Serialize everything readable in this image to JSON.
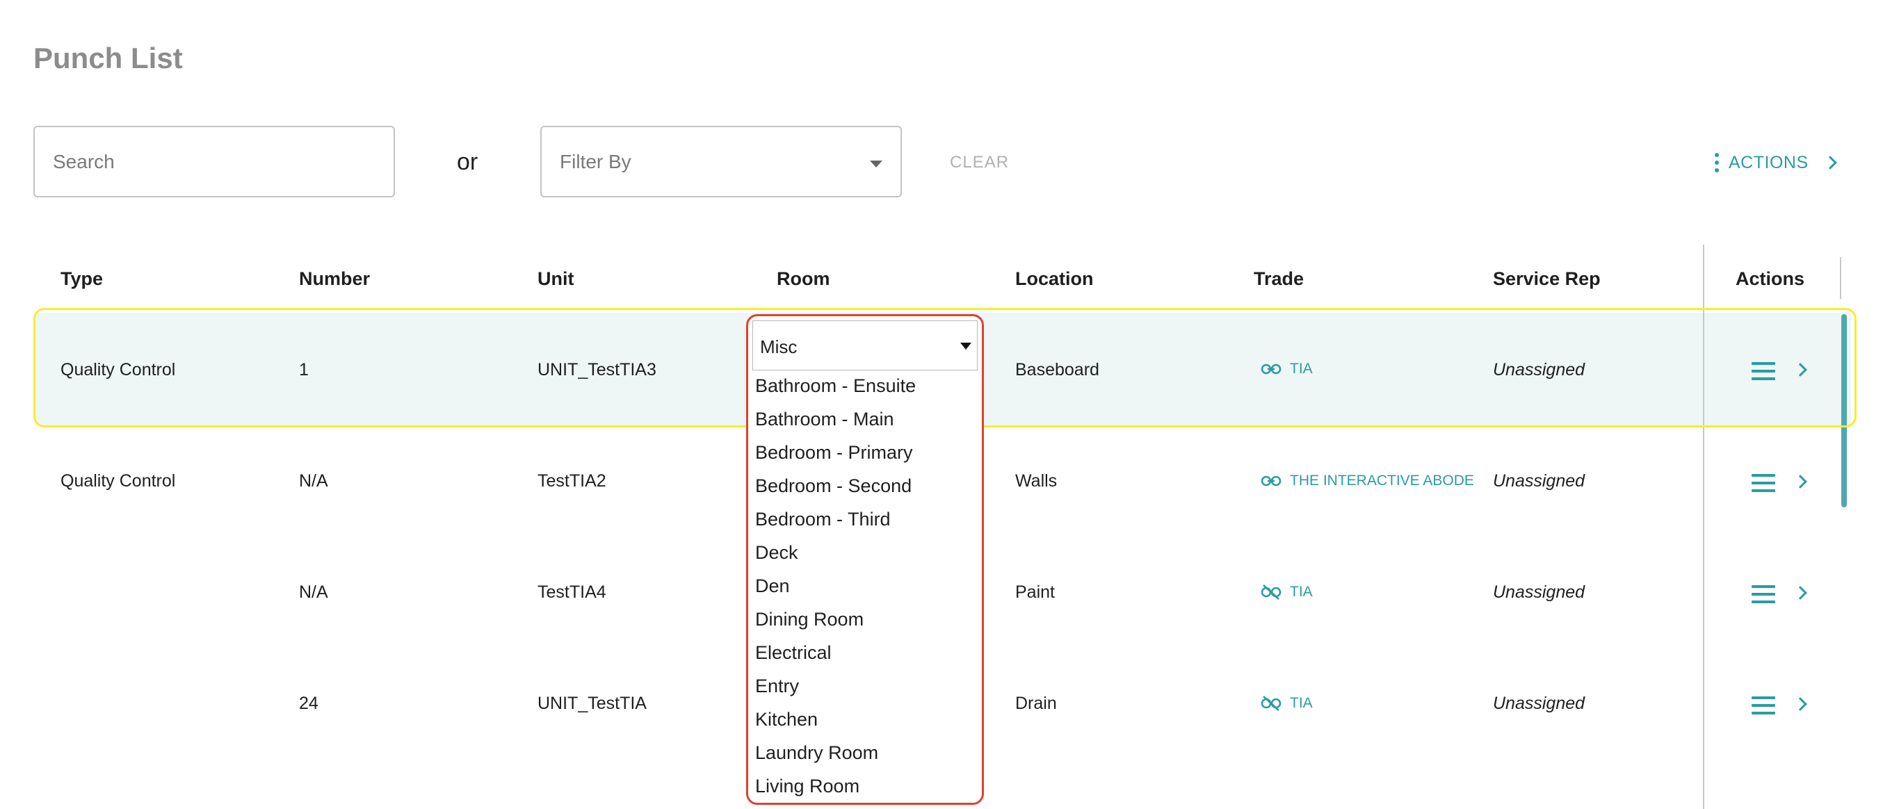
{
  "page": {
    "title": "Punch List"
  },
  "toolbar": {
    "search_placeholder": "Search",
    "or_label": "or",
    "filter_placeholder": "Filter By",
    "clear_label": "CLEAR",
    "actions_label": "ACTIONS"
  },
  "table": {
    "columns": [
      "Type",
      "Number",
      "Unit",
      "Room",
      "Location",
      "Trade",
      "Service Rep",
      "Actions"
    ],
    "rows": [
      {
        "type": "Quality Control",
        "number": "1",
        "unit": "UNIT_TestTIA3",
        "room": "Misc",
        "location": "Baseboard",
        "trade": "TIA",
        "trade_linked": true,
        "service_rep": "Unassigned"
      },
      {
        "type": "Quality Control",
        "number": "N/A",
        "unit": "TestTIA2",
        "room": "",
        "location": "Walls",
        "trade": "THE INTERACTIVE ABODE",
        "trade_linked": true,
        "service_rep": "Unassigned"
      },
      {
        "type": "",
        "number": "N/A",
        "unit": "TestTIA4",
        "room": "",
        "location": "Paint",
        "trade": "TIA",
        "trade_linked": false,
        "service_rep": "Unassigned"
      },
      {
        "type": "",
        "number": "24",
        "unit": "UNIT_TestTIA",
        "room": "",
        "location": "Drain",
        "trade": "TIA",
        "trade_linked": false,
        "service_rep": "Unassigned"
      }
    ]
  },
  "room_dropdown": {
    "selected": "Misc",
    "options": [
      "Bathroom - Ensuite",
      "Bathroom - Main",
      "Bedroom - Primary",
      "Bedroom - Second",
      "Bedroom - Third",
      "Deck",
      "Den",
      "Dining Room",
      "Electrical",
      "Entry",
      "Kitchen",
      "Laundry Room",
      "Living Room"
    ]
  },
  "colors": {
    "accent": "#2a9ca2",
    "selected_row_bg": "#eef6f6",
    "row_highlight_border": "#f4ee2f",
    "dropdown_border": "#e0402e",
    "title_gray": "#8c8c8c"
  },
  "icons": {
    "trade_linked": "link-icon",
    "trade_unlinked": "link-off-icon",
    "row_menu": "menu-icon",
    "row_open": "chevron-right-icon",
    "toolbar_actions": "kebab-icon"
  }
}
